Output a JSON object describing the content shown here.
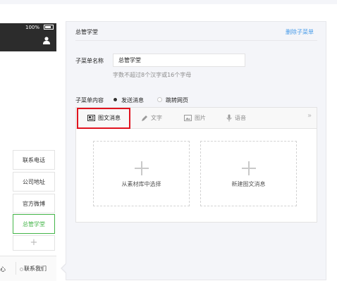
{
  "phone": {
    "battery_text": "100%",
    "submenu_items": [
      {
        "label": "联系电话"
      },
      {
        "label": "公司地址"
      },
      {
        "label": "官方微博"
      },
      {
        "label": "总管学堂",
        "active": true
      }
    ],
    "add_symbol": "+",
    "bottom_menu": {
      "left_fragment": "心",
      "contact_label": "联系我们"
    }
  },
  "panel": {
    "title": "总管学堂",
    "delete_link": "删除子菜单",
    "name_label": "子菜单名称",
    "name_value": "总管学堂",
    "name_hint": "字数不超过8个汉字或16个字母",
    "content_label": "子菜单内容",
    "content_options": [
      {
        "label": "发送消息",
        "selected": true
      },
      {
        "label": "跳转网页",
        "selected": false
      }
    ]
  },
  "editor": {
    "tabs": [
      {
        "label": "图文消息",
        "icon": "news-icon",
        "active": true
      },
      {
        "label": "文字",
        "icon": "pencil-icon"
      },
      {
        "label": "图片",
        "icon": "image-icon"
      },
      {
        "label": "语音",
        "icon": "microphone-icon"
      }
    ],
    "more_symbol": "»",
    "cards": [
      {
        "label": "从素材库中选择"
      },
      {
        "label": "新建图文消息"
      }
    ]
  },
  "colors": {
    "accent_green": "#44b549",
    "link_blue": "#459ae9",
    "highlight_red": "#e0131f"
  }
}
